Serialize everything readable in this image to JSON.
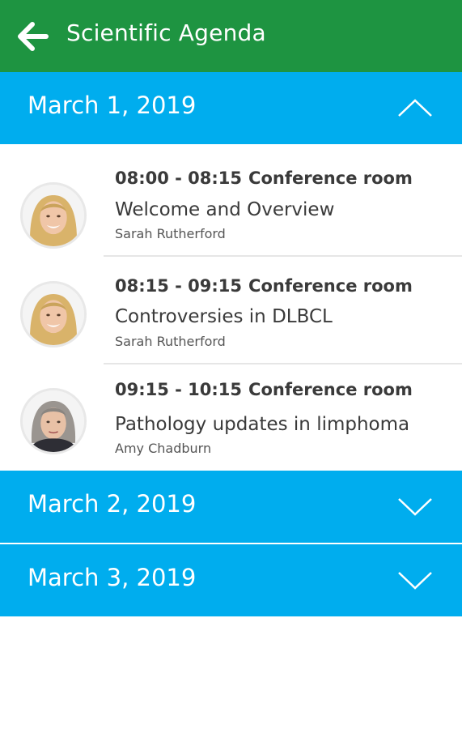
{
  "app_bar": {
    "title": "Scientific Agenda",
    "back_icon": "arrow-left-icon",
    "color": "#1e9441"
  },
  "accent_color": "#00adee",
  "days": [
    {
      "label": "March 1, 2019",
      "expanded": true,
      "chevron_icon": "chevron-up-icon",
      "sessions": [
        {
          "time": "08:00 - 08:15",
          "room": "Conference room",
          "title": "Welcome and Overview",
          "speaker": "Sarah Rutherford",
          "avatar_icon": "speaker-photo-blonde"
        },
        {
          "time": "08:15 - 09:15",
          "room": "Conference room",
          "title": "Controversies in DLBCL",
          "speaker": "Sarah Rutherford",
          "avatar_icon": "speaker-photo-blonde"
        },
        {
          "time": "09:15 - 10:15",
          "room": "Conference room",
          "title": "Pathology updates in limphoma",
          "speaker": "Amy Chadburn",
          "avatar_icon": "speaker-photo-grey-hair"
        }
      ]
    },
    {
      "label": "March 2, 2019",
      "expanded": false,
      "chevron_icon": "chevron-down-icon"
    },
    {
      "label": "March 3, 2019",
      "expanded": false,
      "chevron_icon": "chevron-down-icon"
    }
  ]
}
